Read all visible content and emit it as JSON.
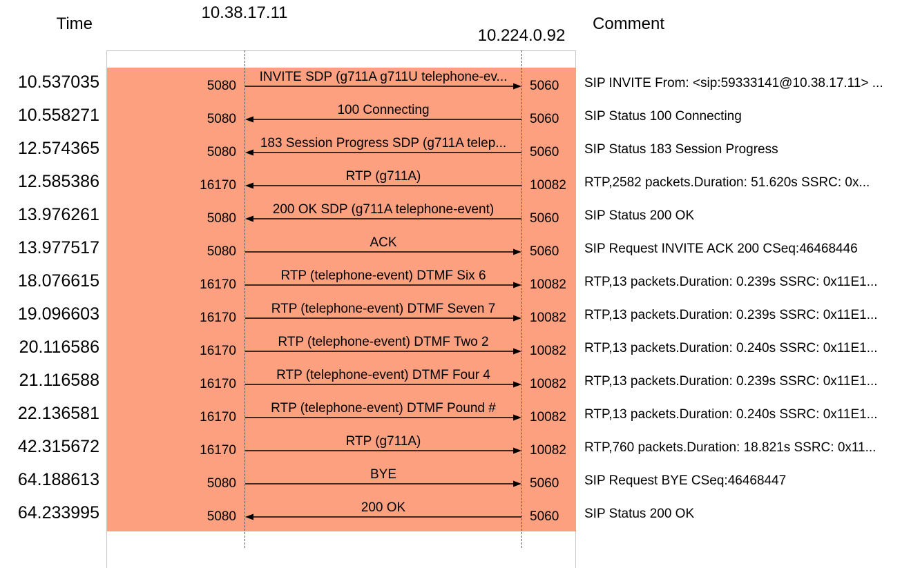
{
  "header": {
    "time_label": "Time",
    "host_a": "10.38.17.11",
    "host_b": "10.224.0.92",
    "comment_label": "Comment"
  },
  "colors": {
    "flow_fill": "#fca07f",
    "arrow": "#000000"
  },
  "rows": [
    {
      "time": "10.537035",
      "port_a": "5080",
      "port_b": "5060",
      "label": "INVITE SDP (g711A g711U telephone-ev...",
      "direction": "right",
      "comment": "SIP INVITE From: <sip:59333141@10.38.17.11> ..."
    },
    {
      "time": "10.558271",
      "port_a": "5080",
      "port_b": "5060",
      "label": "100 Connecting",
      "direction": "left",
      "comment": "SIP Status 100 Connecting"
    },
    {
      "time": "12.574365",
      "port_a": "5080",
      "port_b": "5060",
      "label": "183 Session Progress SDP (g711A telep...",
      "direction": "left",
      "comment": "SIP Status 183 Session Progress"
    },
    {
      "time": "12.585386",
      "port_a": "16170",
      "port_b": "10082",
      "label": "RTP (g711A)",
      "direction": "left",
      "comment": "RTP,2582 packets.Duration: 51.620s SSRC: 0x..."
    },
    {
      "time": "13.976261",
      "port_a": "5080",
      "port_b": "5060",
      "label": "200 OK SDP (g711A telephone-event)",
      "direction": "left",
      "comment": "SIP Status 200 OK"
    },
    {
      "time": "13.977517",
      "port_a": "5080",
      "port_b": "5060",
      "label": "ACK",
      "direction": "right",
      "comment": "SIP Request INVITE ACK 200 CSeq:46468446"
    },
    {
      "time": "18.076615",
      "port_a": "16170",
      "port_b": "10082",
      "label": "RTP (telephone-event) DTMF Six 6",
      "direction": "right",
      "comment": "RTP,13 packets.Duration: 0.239s SSRC: 0x11E1..."
    },
    {
      "time": "19.096603",
      "port_a": "16170",
      "port_b": "10082",
      "label": "RTP (telephone-event) DTMF Seven 7",
      "direction": "right",
      "comment": "RTP,13 packets.Duration: 0.239s SSRC: 0x11E1..."
    },
    {
      "time": "20.116586",
      "port_a": "16170",
      "port_b": "10082",
      "label": "RTP (telephone-event) DTMF Two 2",
      "direction": "right",
      "comment": "RTP,13 packets.Duration: 0.240s SSRC: 0x11E1..."
    },
    {
      "time": "21.116588",
      "port_a": "16170",
      "port_b": "10082",
      "label": "RTP (telephone-event) DTMF Four 4",
      "direction": "right",
      "comment": "RTP,13 packets.Duration: 0.239s SSRC: 0x11E1..."
    },
    {
      "time": "22.136581",
      "port_a": "16170",
      "port_b": "10082",
      "label": "RTP (telephone-event) DTMF Pound #",
      "direction": "right",
      "comment": "RTP,13 packets.Duration: 0.240s SSRC: 0x11E1..."
    },
    {
      "time": "42.315672",
      "port_a": "16170",
      "port_b": "10082",
      "label": "RTP (g711A)",
      "direction": "right",
      "comment": "RTP,760 packets.Duration: 18.821s SSRC: 0x11..."
    },
    {
      "time": "64.188613",
      "port_a": "5080",
      "port_b": "5060",
      "label": "BYE",
      "direction": "right",
      "comment": "SIP Request BYE CSeq:46468447"
    },
    {
      "time": "64.233995",
      "port_a": "5080",
      "port_b": "5060",
      "label": "200 OK",
      "direction": "left",
      "comment": "SIP Status 200 OK"
    }
  ]
}
